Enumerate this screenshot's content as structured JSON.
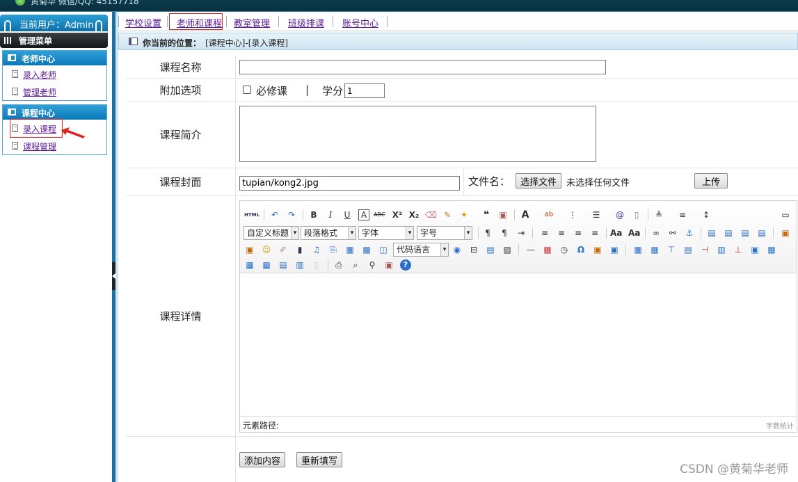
{
  "topbar": {
    "text": "黄菊华 微信/QQ: 45157718"
  },
  "sidebar": {
    "user_label": "当前用户：Admin",
    "menu_title": "管理菜单",
    "groups": [
      {
        "title": "老师中心",
        "items": [
          {
            "label": "录入老师"
          },
          {
            "label": "管理老师"
          }
        ]
      },
      {
        "title": "课程中心",
        "items": [
          {
            "label": "录入课程"
          },
          {
            "label": "课程管理"
          }
        ]
      }
    ]
  },
  "topnav": {
    "tabs": [
      {
        "label": "学校设置"
      },
      {
        "label": "老师和课程"
      },
      {
        "label": "教室管理"
      },
      {
        "label": "班级排课"
      },
      {
        "label": "账号中心"
      }
    ]
  },
  "breadcrumb": {
    "label": "你当前的位置：",
    "value": "[课程中心]-[录入课程]"
  },
  "form": {
    "name_label": "课程名称",
    "name_value": "",
    "options_label": "附加选项",
    "required_label": "必修课",
    "divider": "|",
    "credit_label": "学分",
    "credit_value": "1",
    "intro_label": "课程简介",
    "intro_value": "",
    "cover_label": "课程封面",
    "cover_value": "tupian/kong2.jpg",
    "filename_label": "文件名：",
    "choose_file": "选择文件",
    "no_file": "未选择任何文件",
    "upload": "上传",
    "detail_label": "课程详情",
    "submit": "添加内容",
    "reset": "重新填写"
  },
  "editor": {
    "html_btn": "HTML",
    "selects": {
      "heading": "自定义标题",
      "paragraph": "段落格式",
      "font": "字体",
      "size": "字号",
      "code": "代码语言"
    },
    "path_label": "元素路径:",
    "wordcount": "字数统计"
  },
  "watermark": "CSDN @黄菊华老师"
}
